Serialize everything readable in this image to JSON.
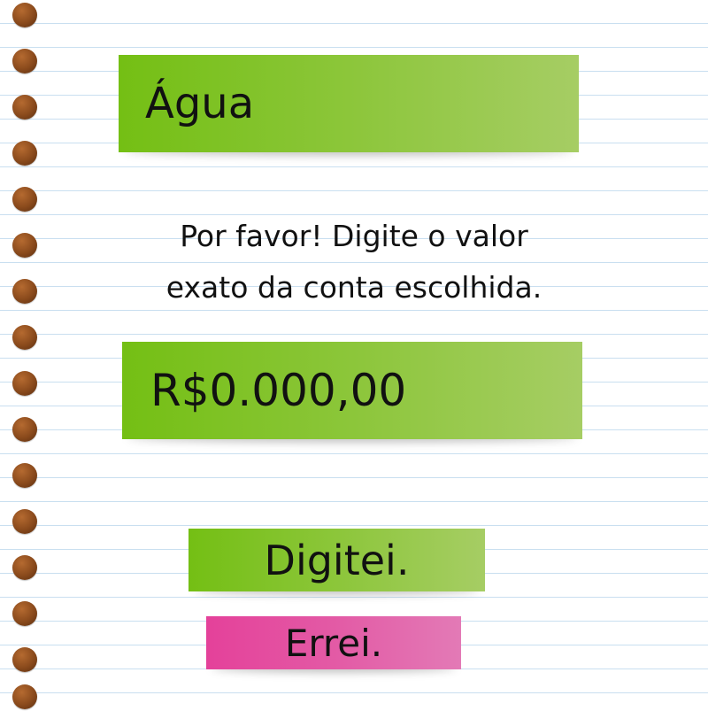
{
  "bill": {
    "title": "Água"
  },
  "instructions": {
    "line1": "Por favor! Digite o valor",
    "line2": "exato da conta escolhida."
  },
  "amount_field": {
    "placeholder": "R$0.000,00",
    "value": ""
  },
  "buttons": {
    "confirm_label": "Digitei.",
    "cancel_label": "Errei."
  },
  "colors": {
    "green_start": "#74bf14",
    "green_end": "#a6cd64",
    "pink_start": "#e4419a",
    "pink_end": "#e37ab6",
    "hole": "#8a4a1c"
  }
}
